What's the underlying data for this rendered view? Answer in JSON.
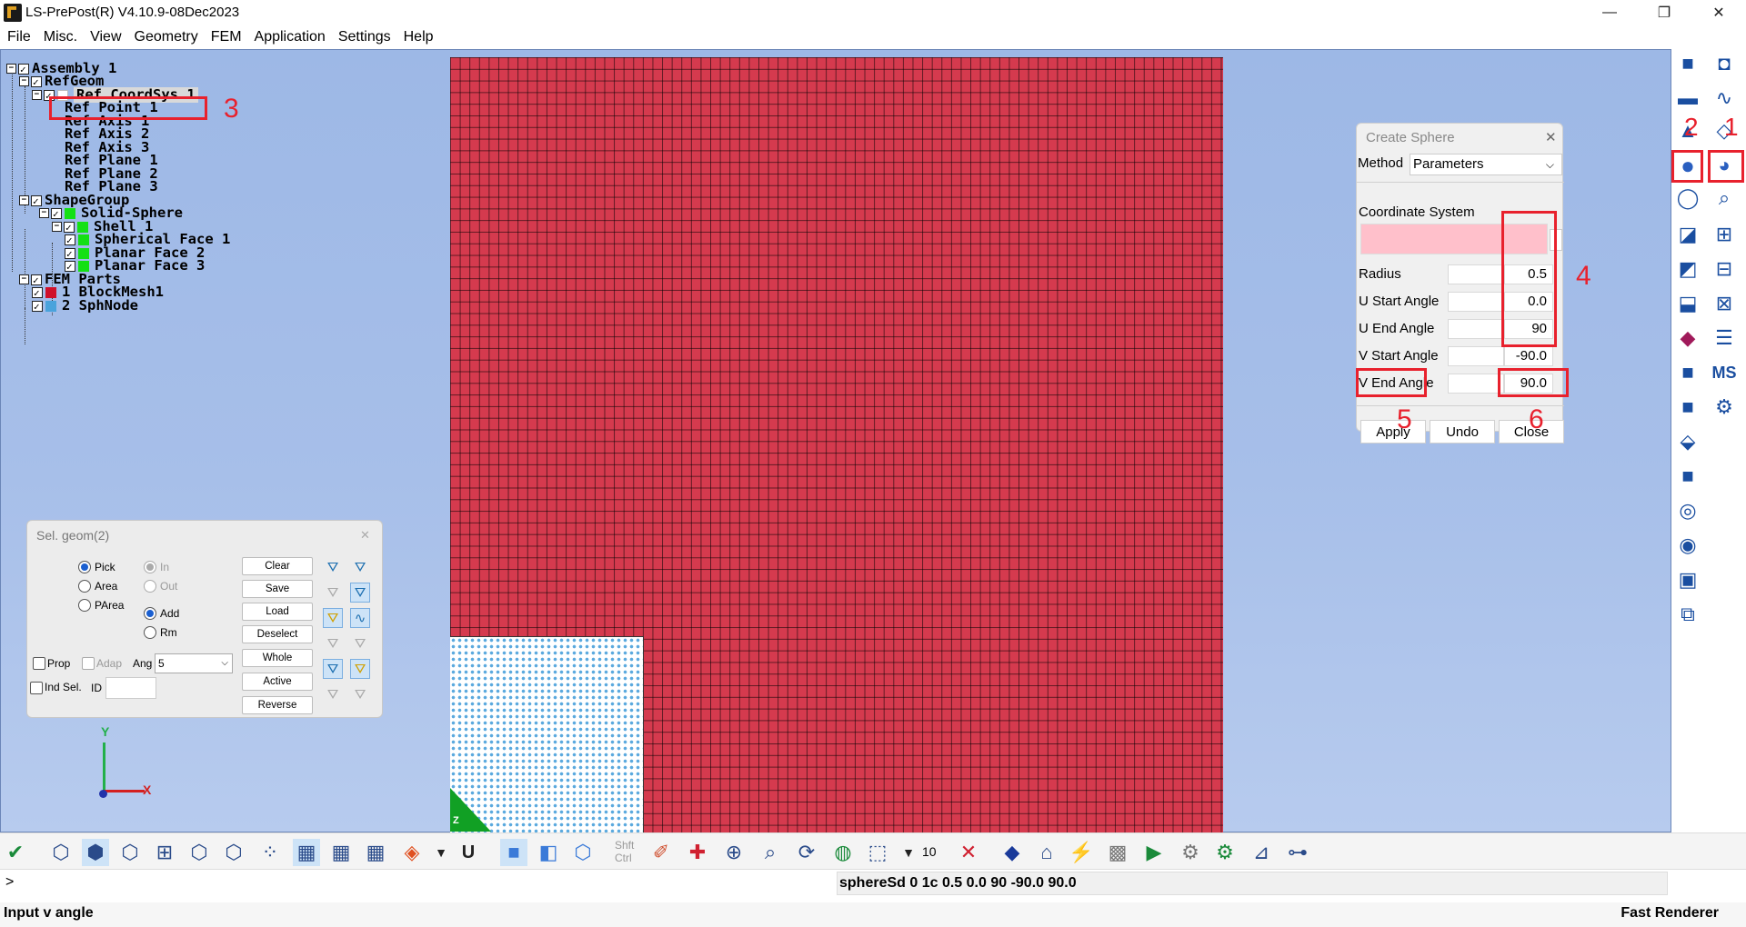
{
  "window": {
    "title": "LS-PrePost(R) V4.10.9-08Dec2023",
    "minimize_glyph": "—",
    "restore_glyph": "❐",
    "close_glyph": "✕"
  },
  "menu": [
    "File",
    "Misc.",
    "View",
    "Geometry",
    "FEM",
    "Application",
    "Settings",
    "Help"
  ],
  "tree": {
    "items": [
      {
        "label": "Assembly 1"
      },
      {
        "label": "RefGeom"
      },
      {
        "label": "Ref CoordSys 1"
      },
      {
        "label": "Ref Point 1"
      },
      {
        "label": "Ref Axis 1"
      },
      {
        "label": "Ref Axis 2"
      },
      {
        "label": "Ref Axis 3"
      },
      {
        "label": "Ref Plane 1"
      },
      {
        "label": "Ref Plane 2"
      },
      {
        "label": "Ref Plane 3"
      },
      {
        "label": "ShapeGroup"
      },
      {
        "label": "Solid-Sphere"
      },
      {
        "label": "Shell 1"
      },
      {
        "label": "Spherical Face 1"
      },
      {
        "label": "Planar Face 2"
      },
      {
        "label": "Planar Face 3"
      },
      {
        "label": "FEM Parts"
      },
      {
        "label": "1 BlockMesh1"
      },
      {
        "label": "2 SphNode"
      }
    ]
  },
  "annotations": {
    "a1": "1",
    "a2": "2",
    "a3": "3",
    "a4": "4",
    "a5": "5",
    "a6": "6"
  },
  "sel_geom": {
    "title": "Sel. geom(2)",
    "close_glyph": "✕",
    "pick": "Pick",
    "area": "Area",
    "parea": "PArea",
    "in": "In",
    "out": "Out",
    "add": "Add",
    "rm": "Rm",
    "prop": "Prop",
    "adap": "Adap",
    "ang": "Ang",
    "ang_value": "5",
    "ind_sel": "Ind Sel.",
    "id": "ID",
    "buttons": {
      "clear": "Clear",
      "save": "Save",
      "load": "Load",
      "deselect": "Deselect",
      "whole": "Whole",
      "active": "Active",
      "reverse": "Reverse"
    }
  },
  "axes": {
    "y": "Y",
    "x": "X",
    "z": "Z"
  },
  "create_sphere": {
    "title": "Create Sphere",
    "close_glyph": "✕",
    "method_label": "Method",
    "method_value": "Parameters",
    "coord_label": "Coordinate System",
    "coord_btn": ".",
    "fields": [
      {
        "label": "Radius",
        "value": "0.5"
      },
      {
        "label": "U Start Angle",
        "value": "0.0"
      },
      {
        "label": "U End Angle",
        "value": "90"
      },
      {
        "label": "V Start Angle",
        "value": "-90.0"
      },
      {
        "label": "V End Angle",
        "value": "90.0"
      }
    ],
    "apply": "Apply",
    "undo": "Undo",
    "close": "Close"
  },
  "toolbar": {
    "shft": "Shft",
    "ctrl": "Ctrl",
    "num": "10",
    "u": "U"
  },
  "right_tools": {
    "ms": "MS"
  },
  "command": {
    "prompt": ">",
    "echo": "sphereSd 0 1c 0.5 0.0 90 -90.0 90.0"
  },
  "status": {
    "left": "Input v angle",
    "right": "Fast Renderer"
  },
  "colors": {
    "mesh_red": "#d53a4e",
    "sph_blue": "#5aa9de",
    "annotation_red": "#e8212d",
    "coord_pink": "#ffc0cb"
  }
}
